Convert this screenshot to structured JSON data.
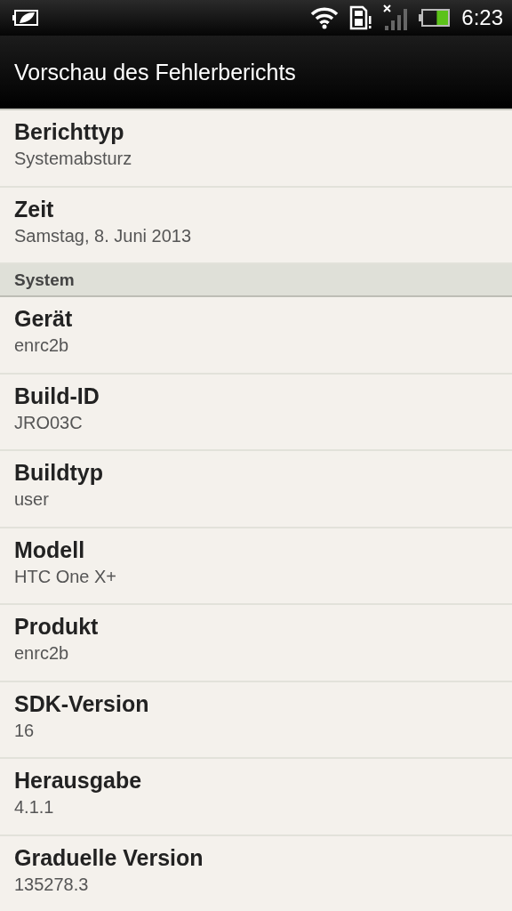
{
  "status_bar": {
    "time": "6:23"
  },
  "title": "Vorschau des Fehlerberichts",
  "entries": [
    {
      "kind": "item",
      "label": "Berichttyp",
      "value": "Systemabsturz"
    },
    {
      "kind": "item",
      "label": "Zeit",
      "value": "Samstag, 8. Juni 2013"
    },
    {
      "kind": "header",
      "label": "System"
    },
    {
      "kind": "item",
      "label": "Gerät",
      "value": "enrc2b"
    },
    {
      "kind": "item",
      "label": "Build-ID",
      "value": "JRO03C"
    },
    {
      "kind": "item",
      "label": "Buildtyp",
      "value": "user"
    },
    {
      "kind": "item",
      "label": "Modell",
      "value": "HTC One X+"
    },
    {
      "kind": "item",
      "label": "Produkt",
      "value": "enrc2b"
    },
    {
      "kind": "item",
      "label": "SDK-Version",
      "value": "16"
    },
    {
      "kind": "item",
      "label": "Herausgabe",
      "value": "4.1.1"
    },
    {
      "kind": "item",
      "label": "Graduelle Version",
      "value": "135278.3"
    }
  ]
}
